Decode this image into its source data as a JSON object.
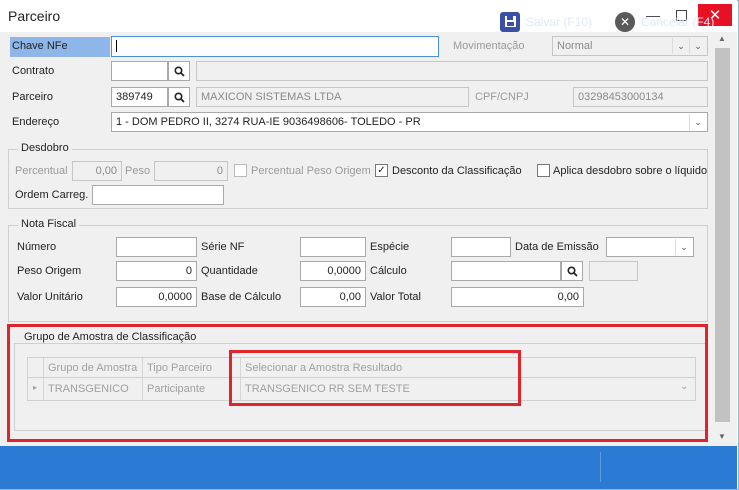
{
  "window": {
    "title": "Parceiro"
  },
  "chave_nfe": {
    "label": "Chave NFe",
    "value": ""
  },
  "movimentacao": {
    "label": "Movimentação",
    "value": "Normal"
  },
  "contrato": {
    "label": "Contrato",
    "value": "",
    "desc": ""
  },
  "parceiro": {
    "label": "Parceiro",
    "code": "389749",
    "name": "MAXICON SISTEMAS LTDA",
    "cpf_label": "CPF/CNPJ",
    "cpf_value": "03298453000134"
  },
  "endereco": {
    "label": "Endereço",
    "value": "1 - DOM PEDRO II, 3274 RUA-IE 9036498606- TOLEDO - PR"
  },
  "desdobro": {
    "title": "Desdobro",
    "percentual_label": "Percentual",
    "percentual_value": "0,00",
    "peso_label": "Peso",
    "peso_value": "0",
    "perc_peso_origem_label": "Percentual Peso Origem",
    "desconto_label": "Desconto da Classificação",
    "aplica_label": "Aplica desdobro sobre o líquido",
    "ordem_label": "Ordem Carreg.",
    "ordem_value": ""
  },
  "nota_fiscal": {
    "title": "Nota Fiscal",
    "numero_label": "Número",
    "serie_label": "Série NF",
    "especie_label": "Espécie",
    "data_label": "Data de Emissão",
    "peso_origem_label": "Peso Origem",
    "peso_origem_value": "0",
    "quantidade_label": "Quantidade",
    "quantidade_value": "0,0000",
    "calculo_label": "Cálculo",
    "valor_unit_label": "Valor Unitário",
    "valor_unit_value": "0,0000",
    "base_label": "Base de Cálculo",
    "base_value": "0,00",
    "valor_total_label": "Valor Total",
    "valor_total_value": "0,00"
  },
  "grupo_amostra": {
    "title": "Grupo de Amostra de Classificação",
    "columns": [
      "Grupo de Amostra",
      "Tipo Parceiro",
      "Selecionar a Amostra Resultado"
    ],
    "row": [
      "TRANSGENICO",
      "Participante",
      "TRANSGENICO RR SEM TESTE"
    ]
  },
  "footer": {
    "save_label": "Salvar (F10)",
    "cancel_label": "Cancelar (F4)"
  },
  "colors": {
    "footer": "#2b7bd5",
    "highlight": "#e0232c",
    "label_highlight": "#8fb6e8"
  }
}
